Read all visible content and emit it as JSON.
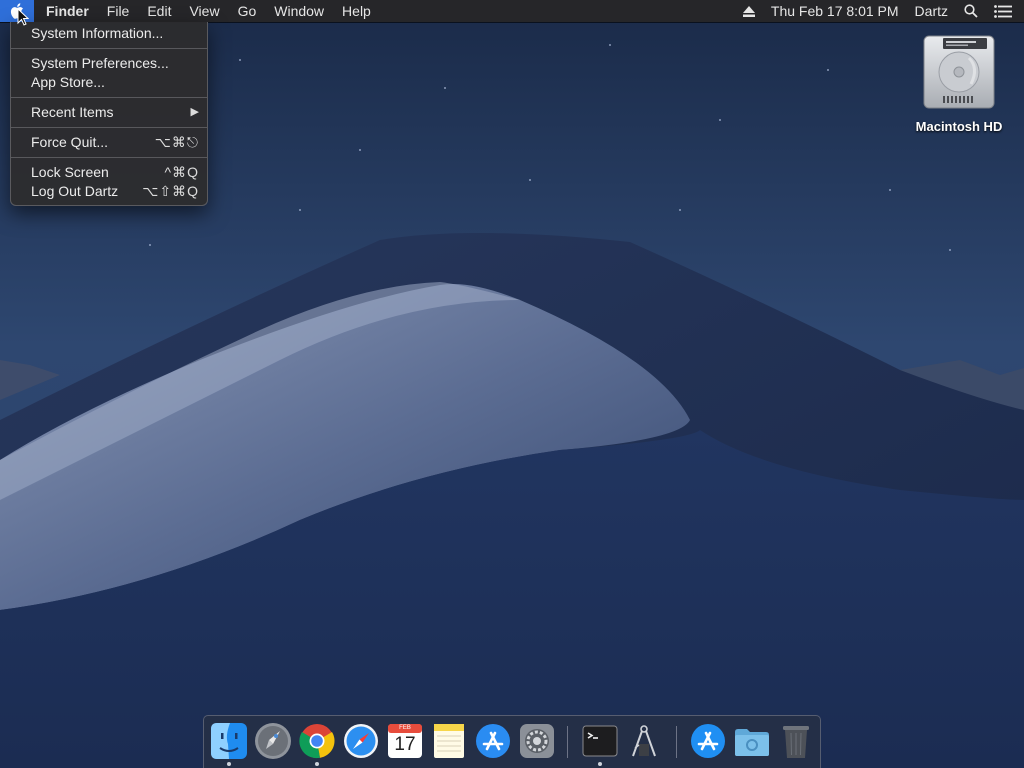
{
  "menubar": {
    "app_name": "Finder",
    "menus": [
      "File",
      "Edit",
      "View",
      "Go",
      "Window",
      "Help"
    ],
    "datetime": "Thu Feb 17  8:01 PM",
    "user": "Dartz"
  },
  "apple_menu": {
    "items": [
      {
        "label": "System Information...",
        "shortcut": ""
      },
      {
        "label": "System Preferences...",
        "shortcut": ""
      },
      {
        "label": "App Store...",
        "shortcut": ""
      },
      {
        "label": "Recent Items",
        "shortcut": ""
      },
      {
        "label": "Force Quit...",
        "shortcut": "⌥⌘⎋"
      },
      {
        "label": "Lock Screen",
        "shortcut": "^⌘Q"
      },
      {
        "label": "Log Out Dartz",
        "shortcut": "⌥⇧⌘Q"
      }
    ]
  },
  "desktop": {
    "drive_label": "Macintosh HD"
  },
  "dock": {
    "calendar_month": "FEB",
    "calendar_day": "17",
    "apps": [
      "finder",
      "launchpad",
      "chrome",
      "safari",
      "calendar",
      "notes",
      "app-store",
      "system-preferences",
      "terminal",
      "script-editor",
      "app-store-alt",
      "downloads-folder",
      "trash"
    ]
  },
  "colors": {
    "menu_highlight": "#2f6fd9",
    "menubar_bg": "#262628",
    "dropdown_bg": "#2c2c2e"
  }
}
